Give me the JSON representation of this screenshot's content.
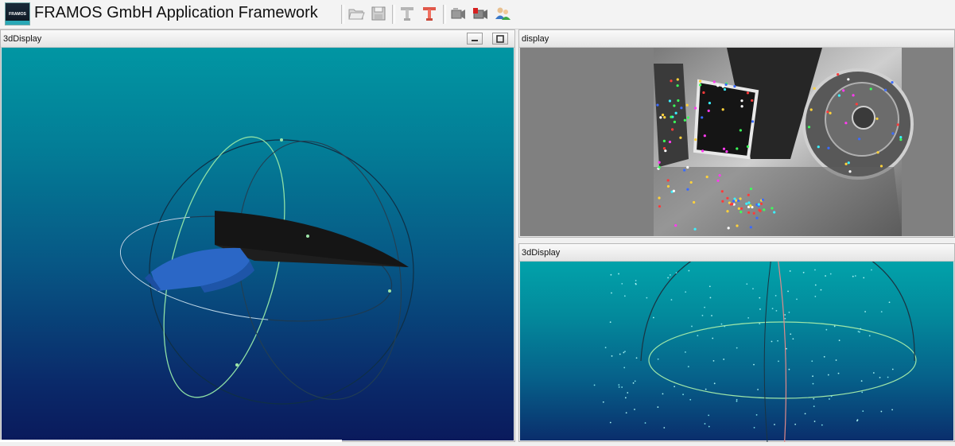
{
  "app": {
    "title": "FRAMOS GmbH  Application Framework",
    "logo_text": "FRAMOS"
  },
  "toolbar": {
    "buttons": [
      {
        "name": "open-folder-icon"
      },
      {
        "name": "save-icon"
      },
      {
        "name": "tool-gray-icon"
      },
      {
        "name": "tool-red-icon"
      },
      {
        "name": "camera-icon"
      },
      {
        "name": "camera-record-icon"
      },
      {
        "name": "users-icon"
      }
    ]
  },
  "panels": {
    "left": {
      "title": "3dDisplay"
    },
    "top_right": {
      "title": "display"
    },
    "bottom_right": {
      "title": "3dDisplay"
    }
  },
  "colors": {
    "scene_top": "#0196a3",
    "scene_bottom": "#0a1a5c",
    "wire_green": "#9ee6a8",
    "wire_dark": "#1a3b4e",
    "model_blue": "#2a66c4",
    "plane_black": "#141414"
  }
}
